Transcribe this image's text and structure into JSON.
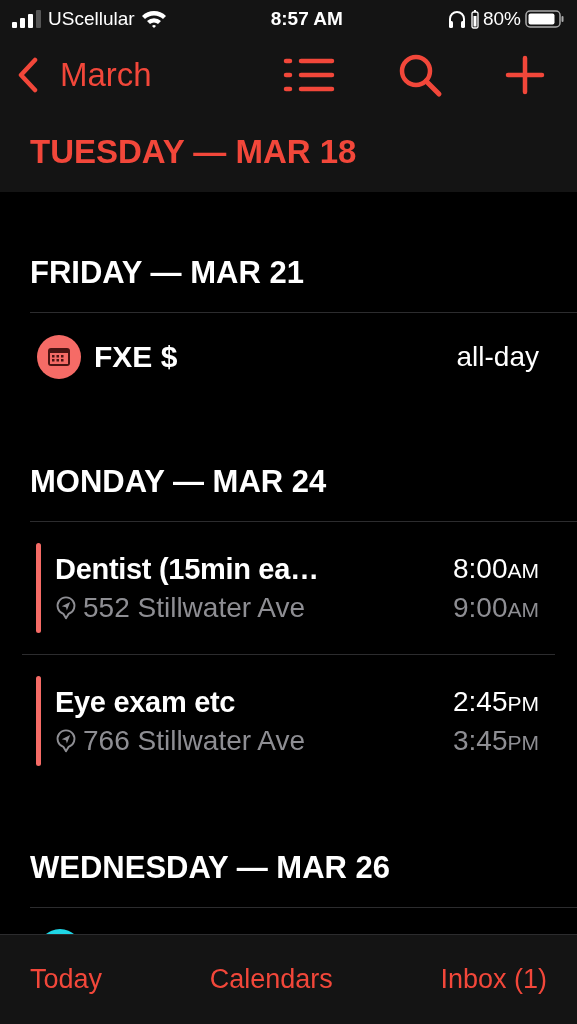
{
  "status_bar": {
    "carrier": "UScellular",
    "time": "8:57 AM",
    "battery": "80%"
  },
  "nav": {
    "back_label": "March"
  },
  "current_day": "TUESDAY — MAR 18",
  "days": [
    {
      "heading": "FRIDAY — MAR 21",
      "events": [
        {
          "kind": "all_day",
          "title": "FXE $",
          "when": "all-day",
          "color": "#f56b66"
        }
      ]
    },
    {
      "heading": "MONDAY — MAR 24",
      "events": [
        {
          "kind": "timed",
          "title": "Dentist (15min ea…",
          "location": "552 Stillwater Ave",
          "start": {
            "time": "8:00",
            "period": "AM"
          },
          "end": {
            "time": "9:00",
            "period": "AM"
          },
          "color": "#f56b66"
        },
        {
          "kind": "timed",
          "title": "Eye exam etc",
          "location": "766 Stillwater Ave",
          "start": {
            "time": "2:45",
            "period": "PM"
          },
          "end": {
            "time": "3:45",
            "period": "PM"
          },
          "color": "#f56b66"
        }
      ]
    },
    {
      "heading": "WEDNESDAY — MAR 26",
      "events": [
        {
          "kind": "dot",
          "color": "#1fd6e6"
        }
      ]
    }
  ],
  "tab_bar": [
    {
      "label": "Today"
    },
    {
      "label": "Calendars"
    },
    {
      "label": "Inbox (1)"
    }
  ]
}
